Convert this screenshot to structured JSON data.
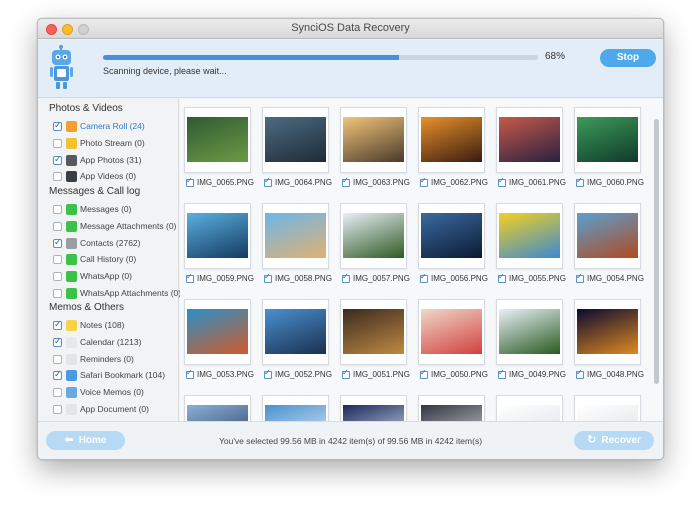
{
  "window": {
    "title": "SynciOS Data Recovery"
  },
  "scan": {
    "progress_pct": 68,
    "progress_label": "68%",
    "status": "Scanning device, please wait...",
    "stop_label": "Stop"
  },
  "sidebar": {
    "sections": [
      {
        "title": "Photos & Videos",
        "items": [
          {
            "label": "Camera Roll (24)",
            "checked": true,
            "selected": true,
            "icon": "camera-roll-icon",
            "color": "#f0a030"
          },
          {
            "label": "Photo Stream (0)",
            "checked": false,
            "icon": "photo-stream-icon",
            "color": "#f2c230"
          },
          {
            "label": "App Photos (31)",
            "checked": true,
            "icon": "camera-icon",
            "color": "#555a60"
          },
          {
            "label": "App Videos (0)",
            "checked": false,
            "icon": "video-icon",
            "color": "#3a3f45"
          }
        ]
      },
      {
        "title": "Messages & Call log",
        "items": [
          {
            "label": "Messages (0)",
            "checked": false,
            "icon": "messages-icon",
            "color": "#3cc24a"
          },
          {
            "label": "Message Attachments (0)",
            "checked": false,
            "icon": "message-attachments-icon",
            "color": "#3cc24a"
          },
          {
            "label": "Contacts (2762)",
            "checked": true,
            "icon": "contacts-icon",
            "color": "#9a9ea4"
          },
          {
            "label": "Call History (0)",
            "checked": false,
            "icon": "phone-icon",
            "color": "#3cc24a"
          },
          {
            "label": "WhatsApp (0)",
            "checked": false,
            "icon": "whatsapp-icon",
            "color": "#3cc24a"
          },
          {
            "label": "WhatsApp Attachments (0)",
            "checked": false,
            "icon": "whatsapp-attachments-icon",
            "color": "#3cc24a"
          }
        ]
      },
      {
        "title": "Memos & Others",
        "items": [
          {
            "label": "Notes (108)",
            "checked": true,
            "icon": "notes-icon",
            "color": "#f5d44a"
          },
          {
            "label": "Calendar (1213)",
            "checked": true,
            "icon": "calendar-icon",
            "color": "#e8e8e8"
          },
          {
            "label": "Reminders (0)",
            "checked": false,
            "icon": "reminders-icon",
            "color": "#e4e4e4"
          },
          {
            "label": "Safari Bookmark (104)",
            "checked": true,
            "icon": "safari-icon",
            "color": "#4b9be0"
          },
          {
            "label": "Voice Memos (0)",
            "checked": false,
            "icon": "voice-memos-icon",
            "color": "#6aa8e2"
          },
          {
            "label": "App Document (0)",
            "checked": false,
            "icon": "document-icon",
            "color": "#e2e6ea"
          }
        ]
      }
    ]
  },
  "photos": [
    {
      "name": "IMG_0065.PNG",
      "colors": [
        "#2e5b32",
        "#6d9a45"
      ]
    },
    {
      "name": "IMG_0064.PNG",
      "colors": [
        "#4d6b83",
        "#1e2b36"
      ]
    },
    {
      "name": "IMG_0063.PNG",
      "colors": [
        "#f2c57a",
        "#4a3a2a"
      ]
    },
    {
      "name": "IMG_0062.PNG",
      "colors": [
        "#e8902a",
        "#3a1c10"
      ]
    },
    {
      "name": "IMG_0061.PNG",
      "colors": [
        "#c55a4a",
        "#2a2040"
      ]
    },
    {
      "name": "IMG_0060.PNG",
      "colors": [
        "#3d9b5a",
        "#0f3a2a"
      ]
    },
    {
      "name": "IMG_0059.PNG",
      "colors": [
        "#5ab0e0",
        "#153a60"
      ]
    },
    {
      "name": "IMG_0058.PNG",
      "colors": [
        "#6cb6ea",
        "#e2b070"
      ]
    },
    {
      "name": "IMG_0057.PNG",
      "colors": [
        "#e8eef8",
        "#2f5a22"
      ]
    },
    {
      "name": "IMG_0056.PNG",
      "colors": [
        "#3a6aa0",
        "#0c1a34"
      ]
    },
    {
      "name": "IMG_0055.PNG",
      "colors": [
        "#f4d020",
        "#3a8ad0"
      ]
    },
    {
      "name": "IMG_0054.PNG",
      "colors": [
        "#5aa0d0",
        "#b04a20"
      ]
    },
    {
      "name": "IMG_0053.PNG",
      "colors": [
        "#2a90c8",
        "#d05a2a"
      ]
    },
    {
      "name": "IMG_0052.PNG",
      "colors": [
        "#4a90d0",
        "#1a3050"
      ]
    },
    {
      "name": "IMG_0051.PNG",
      "colors": [
        "#3a2a20",
        "#c08a40"
      ]
    },
    {
      "name": "IMG_0050.PNG",
      "colors": [
        "#f0d8c8",
        "#d04040"
      ]
    },
    {
      "name": "IMG_0049.PNG",
      "colors": [
        "#e8f0f8",
        "#2a5a20"
      ]
    },
    {
      "name": "IMG_0048.PNG",
      "colors": [
        "#0a0a30",
        "#e08a20"
      ]
    },
    {
      "name": "",
      "colors": [
        "#8ab0d8",
        "#2a3a5a"
      ]
    },
    {
      "name": "",
      "colors": [
        "#4a90d0",
        "#e8f0f8"
      ]
    },
    {
      "name": "",
      "colors": [
        "#1a2a5a",
        "#e0e8f4"
      ]
    },
    {
      "name": "",
      "colors": [
        "#303540",
        "#d8dce0"
      ]
    },
    {
      "name": "",
      "colors": [
        "#ffffff",
        "#d8dde2"
      ]
    },
    {
      "name": "",
      "colors": [
        "#ffffff",
        "#d8dde2"
      ]
    }
  ],
  "bottom": {
    "home_label": "Home",
    "recover_label": "Recover",
    "selection_text": "You've selected 99.56 MB in 4242 item(s) of 99.56 MB in 4242 item(s)"
  }
}
